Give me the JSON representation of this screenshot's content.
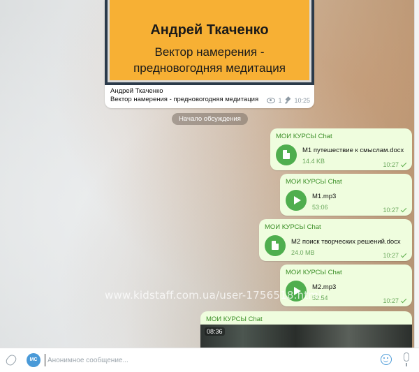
{
  "post": {
    "image_title": "Андрей Ткаченко",
    "image_subtitle": "Вектор намерения - предновогодняя медитация",
    "caption_line1": "Андрей Ткаченко",
    "caption_line2": "Вектор намерения - предновогодняя медитация",
    "views": "1",
    "time": "10:25"
  },
  "discussion_label": "Начало обсуждения",
  "messages": [
    {
      "sender": "МОИ КУРСЫ Chat",
      "file_name": "M1 путешествие к смыслам.docx",
      "size": "14.4 KB",
      "time": "10:27",
      "kind": "document"
    },
    {
      "sender": "МОИ КУРСЫ Chat",
      "file_name": "M1.mp3",
      "size": "53:06",
      "time": "10:27",
      "kind": "audio"
    },
    {
      "sender": "МОИ КУРСЫ Chat",
      "file_name": "M2 поиск творческих решений.docx",
      "size": "24.0 MB",
      "time": "10:27",
      "kind": "document"
    },
    {
      "sender": "МОИ КУРСЫ Chat",
      "file_name": "M2.mp3",
      "size": "52:54",
      "time": "10:27",
      "kind": "audio"
    },
    {
      "sender": "МОИ КУРСЫ Chat",
      "video_duration": "08:36",
      "kind": "video"
    }
  ],
  "watermark": "www.kidstaff.com.ua/user-1756518.html",
  "composer": {
    "avatar_initials": "МС",
    "placeholder": "Анонимное сообщение..."
  },
  "colors": {
    "bubble": "#effdde",
    "accent_green": "#4fae4e",
    "sender_green": "#3a8e26",
    "post_image": "#f7b034",
    "avatar": "#4a9ad8"
  },
  "icons": [
    "eye-icon",
    "pin-icon",
    "document-icon",
    "play-icon",
    "check-icon",
    "attach-icon",
    "emoji-icon",
    "microphone-icon"
  ]
}
